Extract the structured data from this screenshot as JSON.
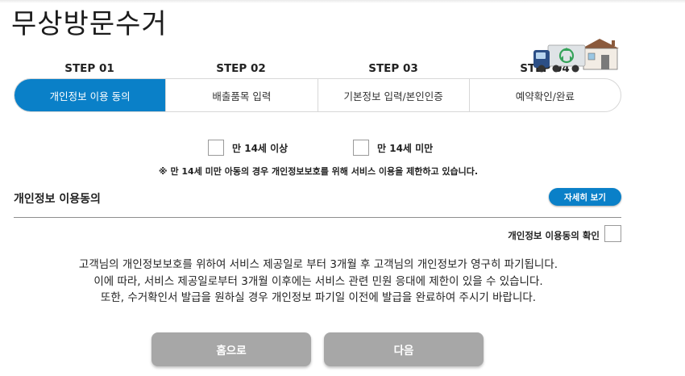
{
  "page": {
    "title": "무상방문수거"
  },
  "steps": [
    {
      "label": "STEP 01",
      "tab": "개인정보 이용 동의",
      "active": true
    },
    {
      "label": "STEP 02",
      "tab": "배출품목 입력",
      "active": false
    },
    {
      "label": "STEP 03",
      "tab": "기본정보 입력/본인인증",
      "active": false
    },
    {
      "label": "STEP 04",
      "tab": "예약확인/완료",
      "active": false
    }
  ],
  "age": {
    "over14_label": "만 14세 이상",
    "under14_label": "만 14세 미만",
    "notice": "※ 만 14세 미만 아동의 경우 개인정보보호를 위해 서비스 이용을 제한하고 있습니다."
  },
  "privacy": {
    "section_title": "개인정보 이용동의",
    "detail_button": "자세히 보기",
    "confirm_label": "개인정보 이용동의 확인",
    "text_lines": [
      "고객님의 개인정보보호를 위하여 서비스 제공일로 부터 3개월 후 고객님의 개인정보가 영구히 파기됩니다.",
      "이에 따라, 서비스 제공일로부터 3개월 이후에는 서비스 관련 민원 응대에 제한이 있을 수 있습니다.",
      "또한, 수거확인서 발급을 원하실 경우 개인정보 파기일 이전에 발급을 완료하여 주시기 바랍니다."
    ]
  },
  "buttons": {
    "home": "홈으로",
    "next": "다음"
  },
  "colors": {
    "accent": "#0a80c8",
    "button_gray": "#a7a7a7"
  },
  "icons": {
    "illustration": "recycling-truck-house-icon"
  }
}
